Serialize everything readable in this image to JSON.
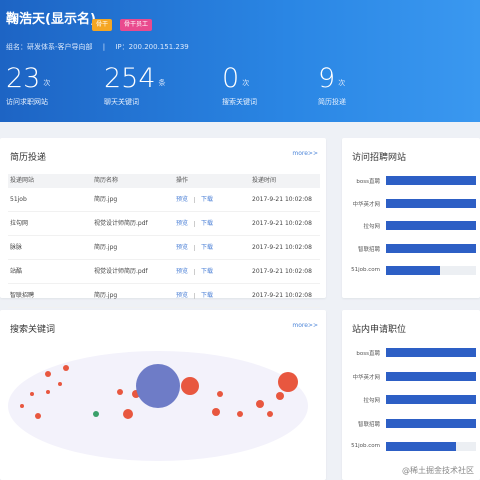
{
  "profile": {
    "name": "鞠浩天(显示名)",
    "badge1": "骨干",
    "badge2": "骨干员工",
    "group": "组名：研发体系-客户导向部",
    "ip": "IP：200.200.151.239"
  },
  "stats": [
    {
      "value": "23",
      "unit": "次",
      "label": "访问求职网站"
    },
    {
      "value": "254",
      "unit": "条",
      "label": "聊天关键词"
    },
    {
      "value": "0",
      "unit": "次",
      "label": "搜索关键词"
    },
    {
      "value": "9",
      "unit": "次",
      "label": "简历投递"
    }
  ],
  "resume_card": {
    "title": "简历投递",
    "more": "more>>",
    "headers": [
      "投递网站",
      "简历名称",
      "操作",
      "投递时间"
    ],
    "preview": "预览",
    "download": "下载",
    "rows": [
      {
        "site": "51job",
        "file": "简历.jpg",
        "time": "2017-9-21 10:02:08"
      },
      {
        "site": "拉勾网",
        "file": "视觉设计师简历.pdf",
        "time": "2017-9-21 10:02:08"
      },
      {
        "site": "脉脉",
        "file": "简历.jpg",
        "time": "2017-9-21 10:02:08"
      },
      {
        "site": "站酷",
        "file": "视觉设计师简历.pdf",
        "time": "2017-9-21 10:02:08"
      },
      {
        "site": "智联招聘",
        "file": "简历.jpg",
        "time": "2017-9-21 10:02:08"
      }
    ]
  },
  "visit_card": {
    "title": "访问招聘网站",
    "chart_data": {
      "type": "bar",
      "orientation": "horizontal",
      "categories": [
        "boss直聘",
        "中华英才网",
        "拉勾网",
        "智联招聘",
        "51job.com"
      ],
      "values": [
        1.0,
        1.0,
        1.0,
        1.0,
        0.6
      ],
      "xlim": [
        0,
        1
      ]
    }
  },
  "keyword_card": {
    "title": "搜索关键词",
    "more": "more>>",
    "chart_data": {
      "type": "scatter",
      "note_colors": {
        "accent": "#e8573f",
        "main": "#6e7cc7",
        "green": "#3aa06a"
      },
      "bubbles": [
        {
          "label": "",
          "size": 3,
          "color": "#e8573f",
          "x": 30,
          "y": 62
        },
        {
          "label": "",
          "size": 2,
          "color": "#e8573f",
          "x": 14,
          "y": 52
        },
        {
          "label": "",
          "size": 2,
          "color": "#e8573f",
          "x": 24,
          "y": 40
        },
        {
          "label": "",
          "size": 2,
          "color": "#e8573f",
          "x": 40,
          "y": 38
        },
        {
          "label": "",
          "size": 2,
          "color": "#e8573f",
          "x": 52,
          "y": 30
        },
        {
          "label": "",
          "size": 3,
          "color": "#3aa06a",
          "x": 88,
          "y": 60
        },
        {
          "label": "",
          "size": 5,
          "color": "#e8573f",
          "x": 120,
          "y": 60
        },
        {
          "label": "",
          "size": 4,
          "color": "#e8573f",
          "x": 128,
          "y": 40
        },
        {
          "label": "",
          "size": 22,
          "color": "#6e7cc7",
          "x": 150,
          "y": 32
        },
        {
          "label": "",
          "size": 9,
          "color": "#e8573f",
          "x": 182,
          "y": 32
        },
        {
          "label": "",
          "size": 3,
          "color": "#e8573f",
          "x": 112,
          "y": 38
        },
        {
          "label": "",
          "size": 4,
          "color": "#e8573f",
          "x": 208,
          "y": 58
        },
        {
          "label": "",
          "size": 3,
          "color": "#e8573f",
          "x": 232,
          "y": 60
        },
        {
          "label": "",
          "size": 4,
          "color": "#e8573f",
          "x": 252,
          "y": 50
        },
        {
          "label": "",
          "size": 3,
          "color": "#e8573f",
          "x": 262,
          "y": 60
        },
        {
          "label": "",
          "size": 4,
          "color": "#e8573f",
          "x": 272,
          "y": 42
        },
        {
          "label": "",
          "size": 10,
          "color": "#e8573f",
          "x": 280,
          "y": 28
        },
        {
          "label": "",
          "size": 3,
          "color": "#e8573f",
          "x": 212,
          "y": 40
        },
        {
          "label": "",
          "size": 3,
          "color": "#e8573f",
          "x": 40,
          "y": 20
        },
        {
          "label": "",
          "size": 3,
          "color": "#e8573f",
          "x": 58,
          "y": 14
        }
      ]
    }
  },
  "apply_card": {
    "title": "站内申请职位",
    "chart_data": {
      "type": "bar",
      "orientation": "horizontal",
      "categories": [
        "boss直聘",
        "中华英才网",
        "拉勾网",
        "智联招聘",
        "51job.com"
      ],
      "values": [
        1.0,
        1.0,
        1.0,
        1.0,
        0.78
      ],
      "xlim": [
        0,
        1
      ]
    }
  },
  "watermark": "@稀土掘金技术社区"
}
